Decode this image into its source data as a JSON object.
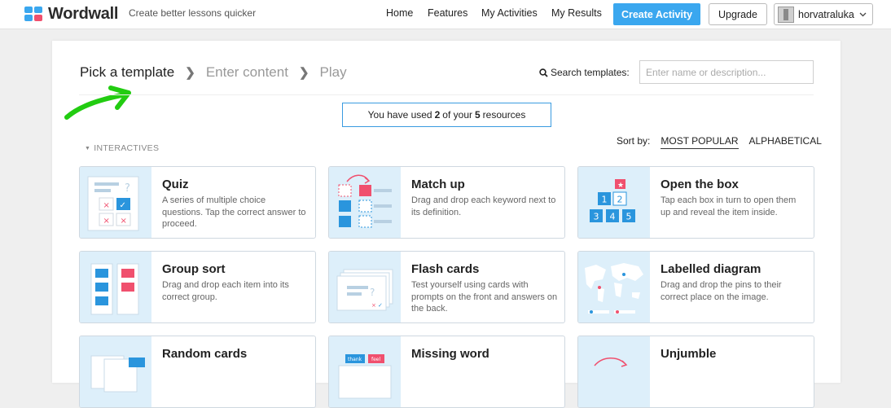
{
  "header": {
    "logo_text": "Wordwall",
    "tagline": "Create better lessons quicker",
    "nav": [
      "Home",
      "Features",
      "My Activities",
      "My Results"
    ],
    "create_label": "Create Activity",
    "upgrade_label": "Upgrade",
    "username": "horvatraluka"
  },
  "steps": {
    "step1": "Pick a template",
    "step2": "Enter content",
    "step3": "Play"
  },
  "search": {
    "label": "Search templates:",
    "placeholder": "Enter name or description..."
  },
  "usage": {
    "prefix": "You have used",
    "used": "2",
    "middle": "of your",
    "total": "5",
    "suffix": "resources"
  },
  "section_label": "INTERACTIVES",
  "sort": {
    "label": "Sort by:",
    "options": [
      "MOST POPULAR",
      "ALPHABETICAL"
    ],
    "selected": "MOST POPULAR"
  },
  "colors": {
    "brand_blue": "#3aa7ef",
    "accent_red": "#f0506e",
    "tile_blue": "#2a95dd",
    "thumb_bg": "#ddeffa",
    "annotation_green": "#22cc11"
  },
  "templates": [
    {
      "title": "Quiz",
      "desc": "A series of multiple choice questions. Tap the correct answer to proceed.",
      "icon": "quiz-icon"
    },
    {
      "title": "Match up",
      "desc": "Drag and drop each keyword next to its definition.",
      "icon": "match-up-icon"
    },
    {
      "title": "Open the box",
      "desc": "Tap each box in turn to open them up and reveal the item inside.",
      "icon": "open-the-box-icon"
    },
    {
      "title": "Group sort",
      "desc": "Drag and drop each item into its correct group.",
      "icon": "group-sort-icon"
    },
    {
      "title": "Flash cards",
      "desc": "Test yourself using cards with prompts on the front and answers on the back.",
      "icon": "flash-cards-icon"
    },
    {
      "title": "Labelled diagram",
      "desc": "Drag and drop the pins to their correct place on the image.",
      "icon": "labelled-diagram-icon"
    },
    {
      "title": "Random cards",
      "desc": "",
      "icon": "random-cards-icon"
    },
    {
      "title": "Missing word",
      "desc": "",
      "icon": "missing-word-icon"
    },
    {
      "title": "Unjumble",
      "desc": "",
      "icon": "unjumble-icon"
    }
  ],
  "thumb_text": {
    "box_numbers": [
      "1",
      "2",
      "3",
      "4",
      "5"
    ],
    "missing_words": [
      "thank",
      "feel"
    ]
  }
}
